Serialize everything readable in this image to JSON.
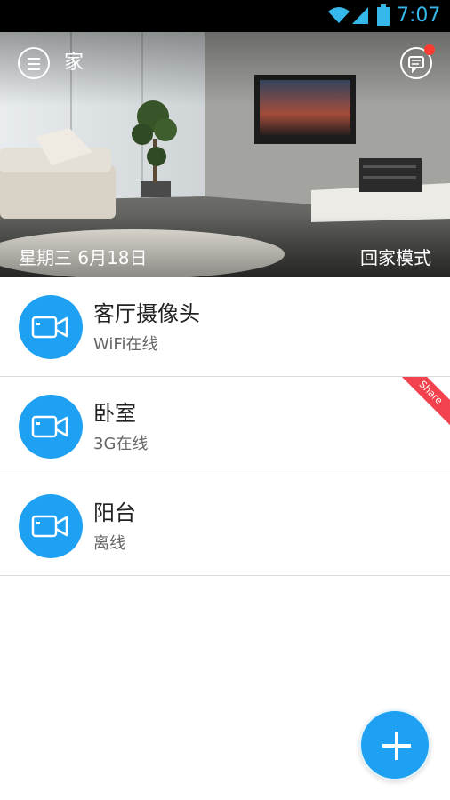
{
  "status_bar": {
    "time": "7:07",
    "icons": [
      "wifi-icon",
      "signal-icon",
      "battery-icon"
    ],
    "accent_color": "#36b7ea"
  },
  "header": {
    "title": "家",
    "date": "星期三  6月18日",
    "mode": "回家模式",
    "menu_icon": "menu-icon",
    "message_icon": "message-icon",
    "has_notification": true
  },
  "devices": [
    {
      "name": "客厅摄像头",
      "status": "WiFi在线",
      "icon": "camera-icon",
      "shared": false
    },
    {
      "name": "卧室",
      "status": "3G在线",
      "icon": "camera-icon",
      "shared": true,
      "badge": "Share"
    },
    {
      "name": "阳台",
      "status": "离线",
      "icon": "camera-icon",
      "shared": false
    }
  ],
  "fab": {
    "icon": "plus-icon"
  },
  "colors": {
    "primary": "#1ea1f2",
    "badge": "#f2424d",
    "notification": "#ff3b30"
  }
}
